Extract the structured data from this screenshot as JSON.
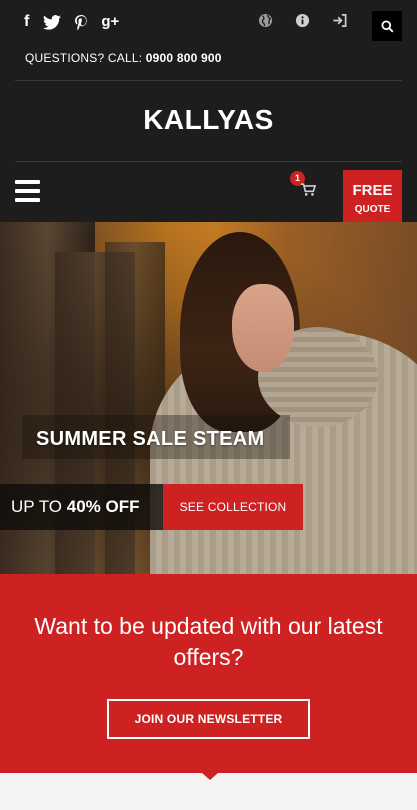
{
  "topbar": {
    "social": [
      "facebook-icon",
      "twitter-icon",
      "pinterest-icon",
      "google-plus-icon"
    ],
    "facebook_glyph": "f",
    "gplus_glyph": "g+",
    "right_icons": [
      "globe-icon",
      "info-icon",
      "login-icon"
    ],
    "search_icon": "search-icon"
  },
  "contact": {
    "label": "QUESTIONS? CALL:",
    "phone": "0900 800 900"
  },
  "logo": {
    "text": "KALLYAS"
  },
  "nav": {
    "menu_icon": "hamburger-icon",
    "cart_count": "1",
    "cart_icon": "cart-icon",
    "quote_line1": "FREE",
    "quote_line2": "QUOTE"
  },
  "hero": {
    "title": "SUMMER SALE STEAM",
    "subtitle_prefix": "UP TO",
    "subtitle_highlight": "40% OFF",
    "cta_label": "SEE COLLECTION"
  },
  "newsletter": {
    "text": "Want to be updated with our latest offers?",
    "button_label": "JOIN OUR NEWSLETTER"
  },
  "colors": {
    "header_bg": "#1d1d1d",
    "accent": "#cd2122",
    "newsletter_bg": "#cd2122"
  }
}
